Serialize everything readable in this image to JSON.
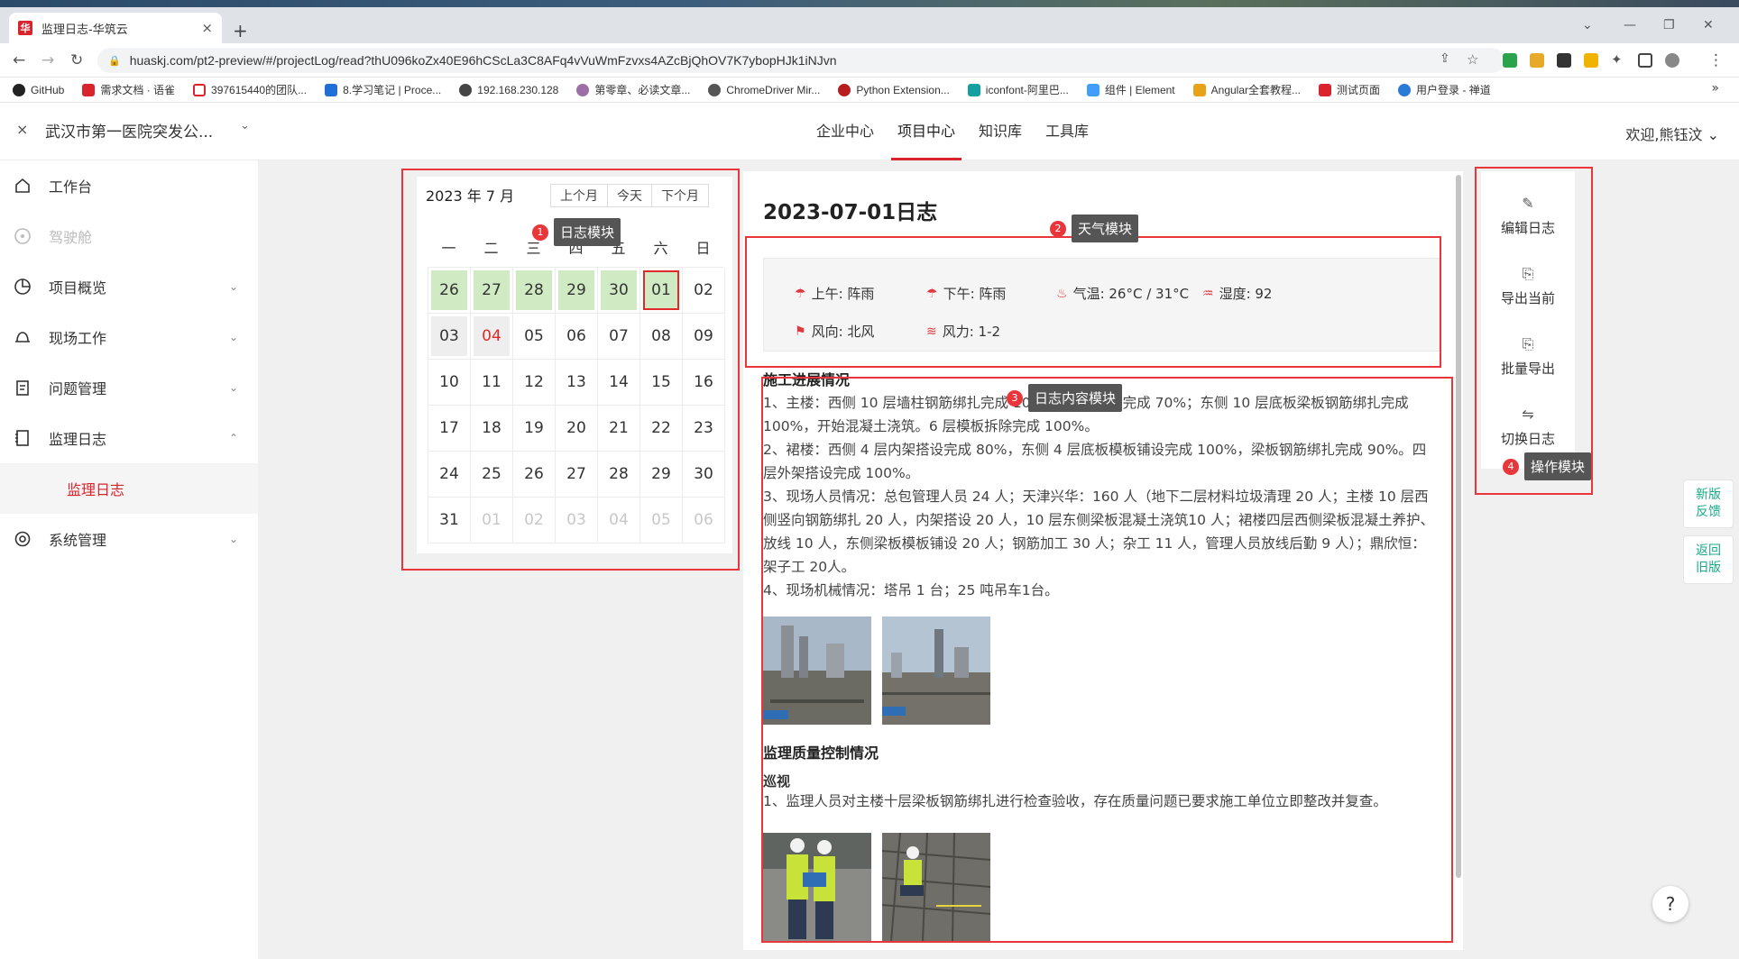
{
  "browser": {
    "tab_title": "监理日志-华筑云",
    "url": "huaskj.com/pt2-preview/#/projectLog/read?thU096koZx40E96hCScLa3C8AFq4vVuWmFzvxs4AZcBjQhOV7K7ybopHJk1iNJvn",
    "bookmarks": [
      "GitHub",
      "需求文档 · 语雀",
      "397615440的团队...",
      "8.学习笔记 | Proce...",
      "192.168.230.128",
      "第零章、必读文章...",
      "ChromeDriver Mir...",
      "Python Extension...",
      "iconfont-阿里巴...",
      "组件 | Element",
      "Angular全套教程...",
      "测试页面",
      "用户登录 - 禅道"
    ],
    "bookmark_more": "»"
  },
  "header": {
    "project_name": "武汉市第一医院突发公...",
    "nav": [
      "企业中心",
      "项目中心",
      "知识库",
      "工具库"
    ],
    "active_nav": "项目中心",
    "welcome": "欢迎,熊钰汶"
  },
  "sidebar": {
    "items": [
      {
        "label": "工作台",
        "icon": "home-icon"
      },
      {
        "label": "驾驶舱",
        "icon": "steering-icon"
      },
      {
        "label": "项目概览",
        "icon": "pie-chart-icon"
      },
      {
        "label": "现场工作",
        "icon": "helmet-icon"
      },
      {
        "label": "问题管理",
        "icon": "clipboard-icon"
      },
      {
        "label": "监理日志",
        "icon": "book-icon"
      },
      {
        "label": "系统管理",
        "icon": "gear-icon"
      }
    ],
    "sub_item": "监理日志"
  },
  "calendar": {
    "title": "2023 年 7 月",
    "buttons": [
      "上个月",
      "今天",
      "下个月"
    ],
    "weekdays": [
      "一",
      "二",
      "三",
      "四",
      "五",
      "六",
      "日"
    ],
    "days": [
      {
        "d": "26",
        "s": "logged"
      },
      {
        "d": "27",
        "s": "logged"
      },
      {
        "d": "28",
        "s": "logged"
      },
      {
        "d": "29",
        "s": "logged"
      },
      {
        "d": "30",
        "s": "logged"
      },
      {
        "d": "01",
        "s": "logged sel"
      },
      {
        "d": "02",
        "s": ""
      },
      {
        "d": "03",
        "s": "gray"
      },
      {
        "d": "04",
        "s": "gray red"
      },
      {
        "d": "05",
        "s": ""
      },
      {
        "d": "06",
        "s": ""
      },
      {
        "d": "07",
        "s": ""
      },
      {
        "d": "08",
        "s": ""
      },
      {
        "d": "09",
        "s": ""
      },
      {
        "d": "10",
        "s": ""
      },
      {
        "d": "11",
        "s": ""
      },
      {
        "d": "12",
        "s": ""
      },
      {
        "d": "13",
        "s": ""
      },
      {
        "d": "14",
        "s": ""
      },
      {
        "d": "15",
        "s": ""
      },
      {
        "d": "16",
        "s": ""
      },
      {
        "d": "17",
        "s": ""
      },
      {
        "d": "18",
        "s": ""
      },
      {
        "d": "19",
        "s": ""
      },
      {
        "d": "20",
        "s": ""
      },
      {
        "d": "21",
        "s": ""
      },
      {
        "d": "22",
        "s": ""
      },
      {
        "d": "23",
        "s": ""
      },
      {
        "d": "24",
        "s": ""
      },
      {
        "d": "25",
        "s": ""
      },
      {
        "d": "26",
        "s": ""
      },
      {
        "d": "27",
        "s": ""
      },
      {
        "d": "28",
        "s": ""
      },
      {
        "d": "29",
        "s": ""
      },
      {
        "d": "30",
        "s": ""
      },
      {
        "d": "31",
        "s": ""
      },
      {
        "d": "01",
        "s": "other"
      },
      {
        "d": "02",
        "s": "other"
      },
      {
        "d": "03",
        "s": "other"
      },
      {
        "d": "04",
        "s": "other"
      },
      {
        "d": "05",
        "s": "other"
      },
      {
        "d": "06",
        "s": "other"
      }
    ]
  },
  "log": {
    "title": "2023-07-01日志",
    "weather": {
      "am": "上午: 阵雨",
      "pm": "下午: 阵雨",
      "temp": "气温: 26°C / 31°C",
      "humidity": "湿度: 92",
      "wind_dir": "风向: 北风",
      "wind_force": "风力: 1-2"
    },
    "section1_title": "施工进展情况",
    "section1_text": "1、主楼：西侧 10 层墙柱钢筋绑扎完成 100%，内架搭设完成 70%；东侧 10 层底板梁板钢筋绑扎完成 100%，开始混凝土浇筑。6 层模板拆除完成 100%。\n2、裙楼：西侧 4 层内架搭设完成 80%，东侧 4 层底板模板铺设完成 100%，梁板钢筋绑扎完成 90%。四层外架搭设完成 100%。\n3、现场人员情况：总包管理人员 24 人；天津兴华：160 人（地下二层材料垃圾清理 20 人；主楼 10 层西侧竖向钢筋绑扎 20 人，内架搭设 20 人，10 层东侧梁板混凝土浇筑10 人；裙楼四层西侧梁板混凝土养护、放线 10 人，东侧梁板模板铺设 20 人；钢筋加工 30 人；杂工 11 人，管理人员放线后勤 9 人）；鼎欣恒：架子工 20人。\n4、现场机械情况：塔吊 1 台；25 吨吊车1台。",
    "section2_title": "监理质量控制情况",
    "section2_sub": "巡视",
    "section2_text": "1、监理人员对主楼十层梁板钢筋绑扎进行检查验收，存在质量问题已要求施工单位立即整改并复查。"
  },
  "ops": [
    "编辑日志",
    "导出当前",
    "批量导出",
    "切换日志"
  ],
  "float": {
    "feedback": [
      "新版",
      "反馈"
    ],
    "back": [
      "返回",
      "旧版"
    ],
    "help": "?"
  },
  "annotations": [
    {
      "num": "1",
      "label": "日志模块"
    },
    {
      "num": "2",
      "label": "天气模块"
    },
    {
      "num": "3",
      "label": "日志内容模块"
    },
    {
      "num": "4",
      "label": "操作模块"
    }
  ],
  "colors": {
    "brand": "#d9232d",
    "annotation": "#e8363b",
    "logged_day": "#d0ebc4",
    "float_text": "#1aaa8a"
  }
}
